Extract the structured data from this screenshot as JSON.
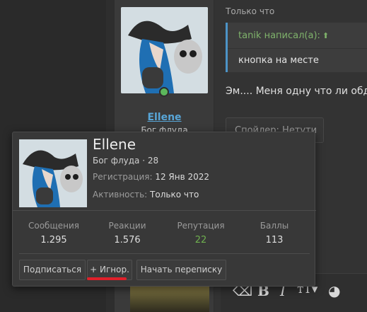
{
  "post": {
    "time": "Только что",
    "username": "Ellene",
    "user_title_partial": "Бог флуда",
    "quote_author": "tanik написал(а):",
    "quote_text": "кнопка на месте",
    "message_text": "Эм.... Меня одну что ли обдел",
    "spoiler_label": "Спойлер: Нетути"
  },
  "popup": {
    "name": "Ellene",
    "title": "Бог флуда · 28",
    "registration_label": "Регистрация:",
    "registration_value": "12 Янв 2022",
    "activity_label": "Активность:",
    "activity_value": "Только что",
    "stats": [
      {
        "label": "Сообщения",
        "value": "1.295"
      },
      {
        "label": "Реакции",
        "value": "1.576"
      },
      {
        "label": "Репутация",
        "value": "22"
      },
      {
        "label": "Баллы",
        "value": "113"
      }
    ],
    "buttons": {
      "follow": "Подписаться",
      "ignore": "+ Игнор.",
      "start_conversation": "Начать переписку"
    }
  },
  "colors": {
    "link": "#58a6d8",
    "online": "#5cb85c",
    "reputation": "#6fb04f",
    "annotation": "#e0202a"
  }
}
